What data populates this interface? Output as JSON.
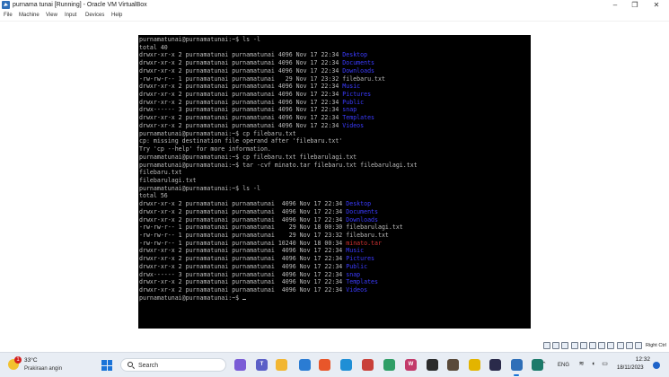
{
  "window": {
    "title": "purnama tunai [Running] - Oracle VM VirtualBox",
    "menu": [
      "File",
      "Machine",
      "View",
      "Input",
      "Devices",
      "Help"
    ],
    "controls": {
      "minimize": "–",
      "restore": "❐",
      "close": "✕"
    }
  },
  "terminal": {
    "lines": [
      [
        {
          "t": "purnamatunai@purnamatunai:~$ ls -l"
        }
      ],
      [
        {
          "t": "total 40"
        }
      ],
      [
        {
          "t": "drwxr-xr-x 2 purnamatunai purnamatunai 4096 Nov 17 22:34 "
        },
        {
          "t": "Desktop",
          "c": "blue"
        }
      ],
      [
        {
          "t": "drwxr-xr-x 2 purnamatunai purnamatunai 4096 Nov 17 22:34 "
        },
        {
          "t": "Documents",
          "c": "blue"
        }
      ],
      [
        {
          "t": "drwxr-xr-x 2 purnamatunai purnamatunai 4096 Nov 17 22:34 "
        },
        {
          "t": "Downloads",
          "c": "blue"
        }
      ],
      [
        {
          "t": "-rw-rw-r-- 1 purnamatunai purnamatunai   29 Nov 17 23:32 filebaru.txt"
        }
      ],
      [
        {
          "t": "drwxr-xr-x 2 purnamatunai purnamatunai 4096 Nov 17 22:34 "
        },
        {
          "t": "Music",
          "c": "blue"
        }
      ],
      [
        {
          "t": "drwxr-xr-x 2 purnamatunai purnamatunai 4096 Nov 17 22:34 "
        },
        {
          "t": "Pictures",
          "c": "blue"
        }
      ],
      [
        {
          "t": "drwxr-xr-x 2 purnamatunai purnamatunai 4096 Nov 17 22:34 "
        },
        {
          "t": "Public",
          "c": "blue"
        }
      ],
      [
        {
          "t": "drwx------ 3 purnamatunai purnamatunai 4096 Nov 17 22:34 "
        },
        {
          "t": "snap",
          "c": "blue"
        }
      ],
      [
        {
          "t": "drwxr-xr-x 2 purnamatunai purnamatunai 4096 Nov 17 22:34 "
        },
        {
          "t": "Templates",
          "c": "blue"
        }
      ],
      [
        {
          "t": "drwxr-xr-x 2 purnamatunai purnamatunai 4096 Nov 17 22:34 "
        },
        {
          "t": "Videos",
          "c": "blue"
        }
      ],
      [
        {
          "t": "purnamatunai@purnamatunai:~$ cp filebaru.txt"
        }
      ],
      [
        {
          "t": "cp: missing destination file operand after 'filebaru.txt'"
        }
      ],
      [
        {
          "t": "Try 'cp --help' for more information."
        }
      ],
      [
        {
          "t": "purnamatunai@purnamatunai:~$ cp filebaru.txt filebarulagi.txt"
        }
      ],
      [
        {
          "t": "purnamatunai@purnamatunai:~$ tar -cvf minato.tar filebaru.txt filebarulagi.txt"
        }
      ],
      [
        {
          "t": "filebaru.txt"
        }
      ],
      [
        {
          "t": "filebarulagi.txt"
        }
      ],
      [
        {
          "t": "purnamatunai@purnamatunai:~$ ls -l"
        }
      ],
      [
        {
          "t": "total 56"
        }
      ],
      [
        {
          "t": "drwxr-xr-x 2 purnamatunai purnamatunai  4096 Nov 17 22:34 "
        },
        {
          "t": "Desktop",
          "c": "blue"
        }
      ],
      [
        {
          "t": "drwxr-xr-x 2 purnamatunai purnamatunai  4096 Nov 17 22:34 "
        },
        {
          "t": "Documents",
          "c": "blue"
        }
      ],
      [
        {
          "t": "drwxr-xr-x 2 purnamatunai purnamatunai  4096 Nov 17 22:34 "
        },
        {
          "t": "Downloads",
          "c": "blue"
        }
      ],
      [
        {
          "t": "-rw-rw-r-- 1 purnamatunai purnamatunai    29 Nov 18 00:30 filebarulagi.txt"
        }
      ],
      [
        {
          "t": "-rw-rw-r-- 1 purnamatunai purnamatunai    29 Nov 17 23:32 filebaru.txt"
        }
      ],
      [
        {
          "t": "-rw-rw-r-- 1 purnamatunai purnamatunai 10240 Nov 18 00:34 "
        },
        {
          "t": "minato.tar",
          "c": "red"
        }
      ],
      [
        {
          "t": "drwxr-xr-x 2 purnamatunai purnamatunai  4096 Nov 17 22:34 "
        },
        {
          "t": "Music",
          "c": "blue"
        }
      ],
      [
        {
          "t": "drwxr-xr-x 2 purnamatunai purnamatunai  4096 Nov 17 22:34 "
        },
        {
          "t": "Pictures",
          "c": "blue"
        }
      ],
      [
        {
          "t": "drwxr-xr-x 2 purnamatunai purnamatunai  4096 Nov 17 22:34 "
        },
        {
          "t": "Public",
          "c": "blue"
        }
      ],
      [
        {
          "t": "drwx------ 3 purnamatunai purnamatunai  4096 Nov 17 22:34 "
        },
        {
          "t": "snap",
          "c": "blue"
        }
      ],
      [
        {
          "t": "drwxr-xr-x 2 purnamatunai purnamatunai  4096 Nov 17 22:34 "
        },
        {
          "t": "Templates",
          "c": "blue"
        }
      ],
      [
        {
          "t": "drwxr-xr-x 2 purnamatunai purnamatunai  4096 Nov 17 22:34 "
        },
        {
          "t": "Videos",
          "c": "blue"
        }
      ],
      [
        {
          "t": "purnamatunai@purnamatunai:~$ "
        },
        {
          "t": "",
          "c": "cursor"
        }
      ]
    ],
    "colors": {
      "fg": "#bdbdbd",
      "blue": "#3b3bff",
      "red": "#d23333",
      "bg": "#000000"
    }
  },
  "vbox_status": {
    "icons": [
      "hard-disk-icon",
      "optical-drive-icon",
      "audio-icon",
      "network-icon",
      "usb-icon",
      "shared-folder-icon",
      "display-icon",
      "recording-icon",
      "cpu-icon",
      "mouse-integration-icon",
      "keyboard-icon"
    ],
    "host_key": "Right Ctrl"
  },
  "taskbar": {
    "weather": {
      "temp": "33°C",
      "desc": "Prakiraan angin",
      "badge": "1"
    },
    "search_label": "Search",
    "apps": [
      {
        "name": "widgets-app-icon",
        "color": "#7a5cd6",
        "glyph": ""
      },
      {
        "name": "teams-app-icon",
        "color": "#5b5fc7",
        "glyph": "T"
      },
      {
        "name": "file-explorer-app-icon",
        "color": "#f2b632",
        "glyph": ""
      },
      {
        "name": "store-app-icon",
        "color": "#2b7cd3",
        "glyph": ""
      },
      {
        "name": "firefox-app-icon",
        "color": "#e8562a",
        "glyph": ""
      },
      {
        "name": "edge-app-icon",
        "color": "#1f8fd6",
        "glyph": ""
      },
      {
        "name": "photos-app-icon",
        "color": "#c9413a",
        "glyph": ""
      },
      {
        "name": "paint-app-icon",
        "color": "#2f9e66",
        "glyph": ""
      },
      {
        "name": "vivaldi-app-icon",
        "color": "#c23a6a",
        "glyph": "W"
      },
      {
        "name": "terminal-app-icon",
        "color": "#2b2b2b",
        "glyph": ""
      },
      {
        "name": "capture-app-icon",
        "color": "#5a4a3a",
        "glyph": ""
      },
      {
        "name": "chrome-app-icon",
        "color": "#e3b400",
        "glyph": ""
      },
      {
        "name": "vscode-app-icon",
        "color": "#2a2a4a",
        "glyph": ""
      },
      {
        "name": "virtualbox-app-icon",
        "color": "#2f6fb8",
        "glyph": ""
      },
      {
        "name": "dev-app-icon",
        "color": "#1c7a6a",
        "glyph": ""
      }
    ],
    "tray": {
      "lang": "ENG",
      "time": "12:32",
      "date": "18/11/2023"
    }
  }
}
